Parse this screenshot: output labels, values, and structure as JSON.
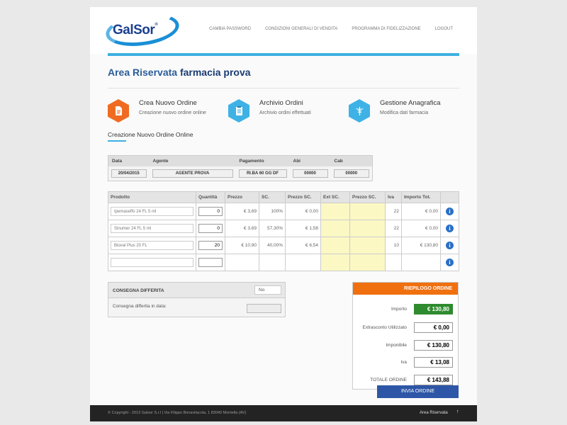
{
  "header": {
    "logo_text": "GalSor",
    "nav": [
      "CAMBIA PASSWORD",
      "CONDIZIONI GENERALI DI VENDITA",
      "PROGRAMMA DI FIDELIZZAZIONE",
      "LOGOUT"
    ]
  },
  "page": {
    "title_prefix": "Area Riservata",
    "title_bold": "farmacia prova"
  },
  "features": [
    {
      "title": "Crea Nuovo Ordine",
      "subtitle": "Creazione nuovo ordine online",
      "color": "#f06b22",
      "icon": "document-icon"
    },
    {
      "title": "Archivio Ordini",
      "subtitle": "Archivio ordini effettuati",
      "color": "#3fb2e5",
      "icon": "clipboard-icon"
    },
    {
      "title": "Gestione Anagrafica",
      "subtitle": "Modifica dati farmacia",
      "color": "#3fb2e5",
      "icon": "caduceus-icon"
    }
  ],
  "section_title": "Creazione Nuovo Ordine Online",
  "order_header": {
    "columns": [
      "Data",
      "Agente",
      "Pagamento",
      "Abi",
      "Cab"
    ],
    "values": [
      "20/04/2015",
      "AGENTE PROVA",
      "RI.BA 60 GG DF",
      "00000",
      "00000"
    ]
  },
  "products": {
    "columns": [
      "Prodotto",
      "Quantità",
      "Prezzo",
      "SC.",
      "Prezzo SC.",
      "Ext SC.",
      "Prezzo SC.",
      "Iva",
      "Importo Tot."
    ],
    "rows": [
      {
        "name": "Ipemaseffo 24 FL 5 ml",
        "qty": "0",
        "price": "€ 3,69",
        "sc": "100%",
        "price_sc": "€ 0,00",
        "ext_sc": "",
        "price_sc2": "",
        "iva": "22",
        "total": "€ 0,00"
      },
      {
        "name": "Sinumer 24 FL 5 ml",
        "qty": "0",
        "price": "€ 3,69",
        "sc": "57,30%",
        "price_sc": "€ 1,58",
        "ext_sc": "",
        "price_sc2": "",
        "iva": "22",
        "total": "€ 0,00"
      },
      {
        "name": "Bioval Plus 20 FL",
        "qty": "20",
        "price": "€ 10,90",
        "sc": "40,00%",
        "price_sc": "€ 6,54",
        "ext_sc": "",
        "price_sc2": "",
        "iva": "10",
        "total": "€ 130,80"
      },
      {
        "name": "",
        "qty": "",
        "price": "",
        "sc": "",
        "price_sc": "",
        "ext_sc": "",
        "price_sc2": "",
        "iva": "",
        "total": ""
      }
    ]
  },
  "consegna": {
    "title": "CONSEGNA DIFFERITA",
    "select_value": "No",
    "date_label": "Consegna differita in data:"
  },
  "riepilogo": {
    "title": "RIEPILOGO ORDINE",
    "rows": [
      {
        "label": "Importo",
        "value": "€ 130,80"
      },
      {
        "label": "Extrasconto Utilizzato",
        "value": "€ 0,00"
      },
      {
        "label": "Imponibile",
        "value": "€ 130,80"
      },
      {
        "label": "Iva",
        "value": "€ 13,08"
      },
      {
        "label": "TOTALE ORDINE",
        "value": "€ 143,88"
      }
    ],
    "submit_label": "INVIA ORDINE"
  },
  "footer": {
    "copyright": "© Copyright - 2013 Galsor S.r.l | Via Filippo Bonavitacola, 1 83040 Montella (AV)",
    "area_link": "Area Riservata",
    "up_arrow": "↑"
  },
  "colors": {
    "accent": "#3db0e0",
    "orange": "#f07010",
    "green": "#2e8b2e",
    "button": "#2d56a6"
  }
}
